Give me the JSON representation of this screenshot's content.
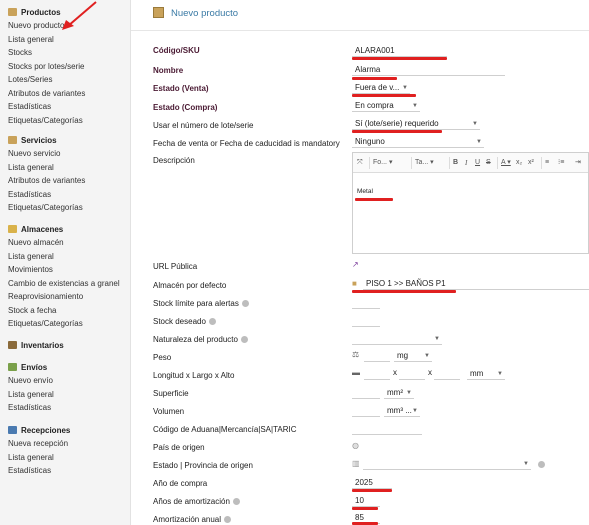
{
  "sidebar": {
    "sections": [
      {
        "title": "Productos",
        "color": "#c9a25a",
        "items": [
          "Nuevo producto",
          "Lista general",
          "Stocks",
          "Stocks por lotes/serie",
          "Lotes/Series",
          "Atributos de variantes",
          "Estadísticas",
          "Etiquetas/Categorías"
        ]
      },
      {
        "title": "Servicios",
        "color": "#c9a25a",
        "items": [
          "Nuevo servicio",
          "Lista general",
          "Atributos de variantes",
          "Estadísticas",
          "Etiquetas/Categorías"
        ]
      },
      {
        "title": "Almacenes",
        "color": "#d9b24a",
        "items": [
          "Nuevo almacén",
          "Lista general",
          "Movimientos",
          "Cambio de existencias a granel",
          "Reaprovisionamiento",
          "Stock a fecha",
          "Etiquetas/Categorías"
        ]
      },
      {
        "title": "Inventarios",
        "color": "#8a6a3a",
        "items": []
      },
      {
        "title": "Envíos",
        "color": "#7aa04a",
        "items": [
          "Nuevo envío",
          "Lista general",
          "Estadísticas"
        ]
      },
      {
        "title": "Recepciones",
        "color": "#4a7ab0",
        "items": [
          "Nueva recepción",
          "Lista general",
          "Estadísticas"
        ]
      }
    ]
  },
  "header": {
    "title": "Nuevo producto"
  },
  "form": {
    "sku_label": "Código/SKU",
    "sku_value": "ALARA001",
    "nombre_label": "Nombre",
    "nombre_value": "Alarma",
    "estado_venta_label": "Estado (Venta)",
    "estado_venta_value": "Fuera de v...",
    "estado_compra_label": "Estado (Compra)",
    "estado_compra_value": "En compra",
    "lote_label": "Usar el número de lote/serie",
    "lote_value": "Sí (lote/serie) requerido",
    "fecha_label": "Fecha de venta or Fecha de caducidad is mandatory",
    "fecha_value": "Ninguno",
    "descripcion_label": "Descripción",
    "descripcion_value": "Metal",
    "toolbar_font": "Fo...",
    "toolbar_size": "Ta...",
    "url_label": "URL Pública",
    "almacen_label": "Almacén por defecto",
    "almacen_value": "PISO 1 >> BAÑOS P1",
    "stock_limite_label": "Stock límite para alertas",
    "stock_deseado_label": "Stock deseado",
    "naturaleza_label": "Naturaleza del producto",
    "peso_label": "Peso",
    "peso_unit": "mg",
    "dimensiones_label": "Longitud x Largo x Alto",
    "dim_x1": "x",
    "dim_x2": "x",
    "dim_unit": "mm",
    "superficie_label": "Superficie",
    "superficie_unit": "mm²",
    "volumen_label": "Volumen",
    "volumen_unit": "mm³ ...",
    "aduana_label": "Código de Aduana|Mercancía|SA|TARIC",
    "pais_label": "País de origen",
    "provincia_label": "Estado | Provincia de origen",
    "anio_compra_label": "Año de compra",
    "anio_compra_value": "2025",
    "anios_amort_label": "Años de amortización",
    "anios_amort_value": "10",
    "amort_anual_label": "Amortización anual",
    "amort_anual_value": "85"
  },
  "accent": "#3a7aa5",
  "annotation_color": "#e02020"
}
